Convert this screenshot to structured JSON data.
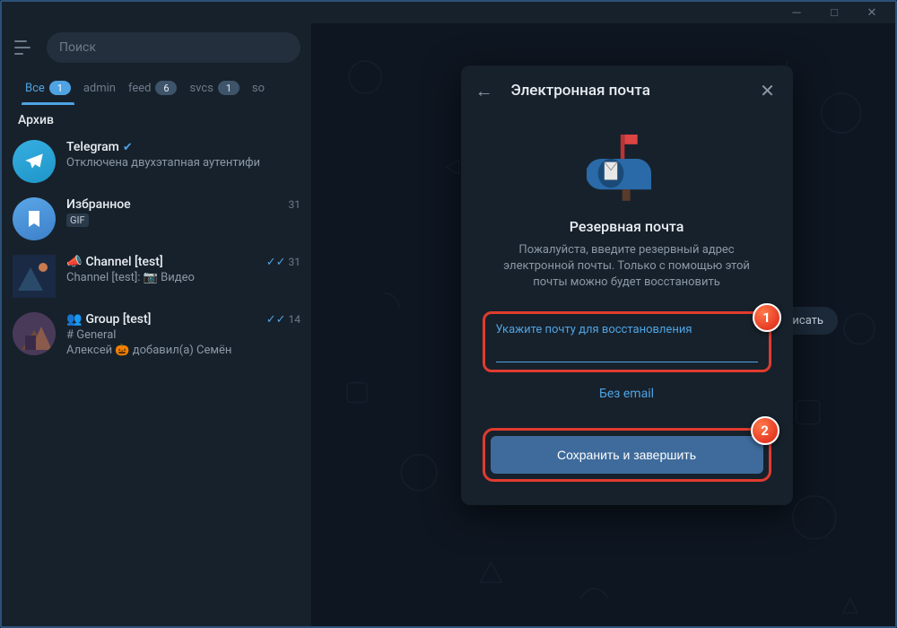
{
  "window": {
    "minimize": "─",
    "maximize": "□",
    "close": "✕"
  },
  "search": {
    "placeholder": "Поиск"
  },
  "folders": [
    {
      "label": "Все",
      "badge": "1",
      "active": true
    },
    {
      "label": "admin",
      "badge": null
    },
    {
      "label": "feed",
      "badge": "6"
    },
    {
      "label": "svcs",
      "badge": "1"
    },
    {
      "label": "so",
      "badge": null
    }
  ],
  "archive_header": "Архив",
  "chats": [
    {
      "name": "Telegram",
      "verified": true,
      "msg": "Отключена двухэтапная аутентифи",
      "time": ""
    },
    {
      "name": "Избранное",
      "msg": "GIF",
      "time": "31",
      "mini": true,
      "saved": true
    },
    {
      "name": "Channel [test]",
      "msg": "Channel [test]: 📷 Видео",
      "time": "31",
      "checks": true,
      "icon": "📣"
    },
    {
      "name": "Group [test]",
      "msg_top": "# General",
      "msg": "Алексей 🎃 добавил(а) Семён",
      "time": "14",
      "checks": true,
      "icon": "👥"
    }
  ],
  "hint": "ли бы написать",
  "dialog": {
    "title": "Электронная почта",
    "heading": "Резервная почта",
    "desc": "Пожалуйста, введите резервный адрес электронной почты. Только с помощью этой почты можно будет восстановить",
    "field_label": "Укажите почту для восстановления",
    "skip": "Без email",
    "button": "Сохранить и завершить",
    "marker1": "1",
    "marker2": "2"
  }
}
